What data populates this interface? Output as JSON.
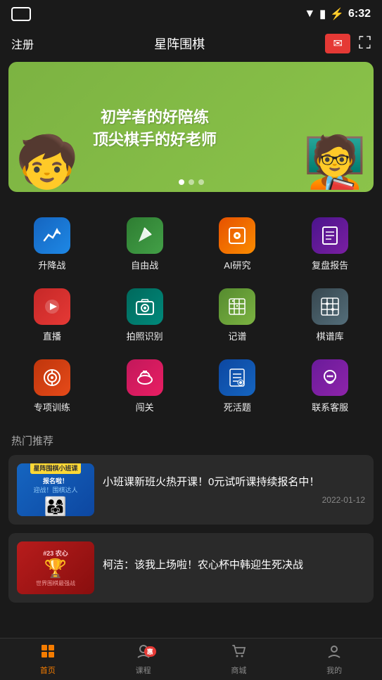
{
  "status": {
    "time": "6:32",
    "wifi_icon": "▼",
    "signal_icon": "⚡",
    "battery_icon": "🔋"
  },
  "topbar": {
    "register": "注册",
    "title": "星阵围棋",
    "envelope_icon": "✉",
    "qr_icon": "⛶"
  },
  "banner": {
    "line1": "初学者的好陪练",
    "line2": "顶尖棋手的好老师",
    "dots": [
      true,
      false,
      false
    ]
  },
  "grid_items": [
    {
      "label": "升降战",
      "icon_class": "ic-upgrade",
      "icon": "📊"
    },
    {
      "label": "自由战",
      "icon_class": "ic-free",
      "icon": "✈"
    },
    {
      "label": "AI研究",
      "icon_class": "ic-ai",
      "icon": "🔍"
    },
    {
      "label": "复盘报告",
      "icon_class": "ic-review",
      "icon": "📋"
    },
    {
      "label": "直播",
      "icon_class": "ic-live",
      "icon": "▶"
    },
    {
      "label": "拍照识别",
      "icon_class": "ic-photo",
      "icon": "📷"
    },
    {
      "label": "记谱",
      "icon_class": "ic-record",
      "icon": "🎯"
    },
    {
      "label": "棋谱库",
      "icon_class": "ic-kifu",
      "icon": "⊞"
    },
    {
      "label": "专项训练",
      "icon_class": "ic-train",
      "icon": "🎯"
    },
    {
      "label": "闯关",
      "icon_class": "ic-pass",
      "icon": "🚀"
    },
    {
      "label": "死活题",
      "icon_class": "ic-dead",
      "icon": "📜"
    },
    {
      "label": "联系客服",
      "icon_class": "ic-service",
      "icon": "💬"
    }
  ],
  "section_title": "热门推荐",
  "news": [
    {
      "id": 1,
      "thumb_type": "thumb1",
      "thumb_badge": "星阵围棋小班课",
      "thumb_sub": "报名啦！",
      "title": "小班课新班火热开课！0元试听课持续报名中！",
      "date": "2022-01-12"
    },
    {
      "id": 2,
      "thumb_type": "thumb2",
      "thumb_text": "#23 农心杯",
      "title": "柯洁：该我上场啦！农心杯中韩迎生死决战",
      "date": ""
    }
  ],
  "bottom_nav": [
    {
      "label": "首页",
      "icon": "⊞",
      "active": true,
      "badge": ""
    },
    {
      "label": "课程",
      "icon": "👤",
      "active": false,
      "badge": "惠"
    },
    {
      "label": "商城",
      "icon": "🛒",
      "active": false,
      "badge": ""
    },
    {
      "label": "我的",
      "icon": "👤",
      "active": false,
      "badge": ""
    }
  ]
}
